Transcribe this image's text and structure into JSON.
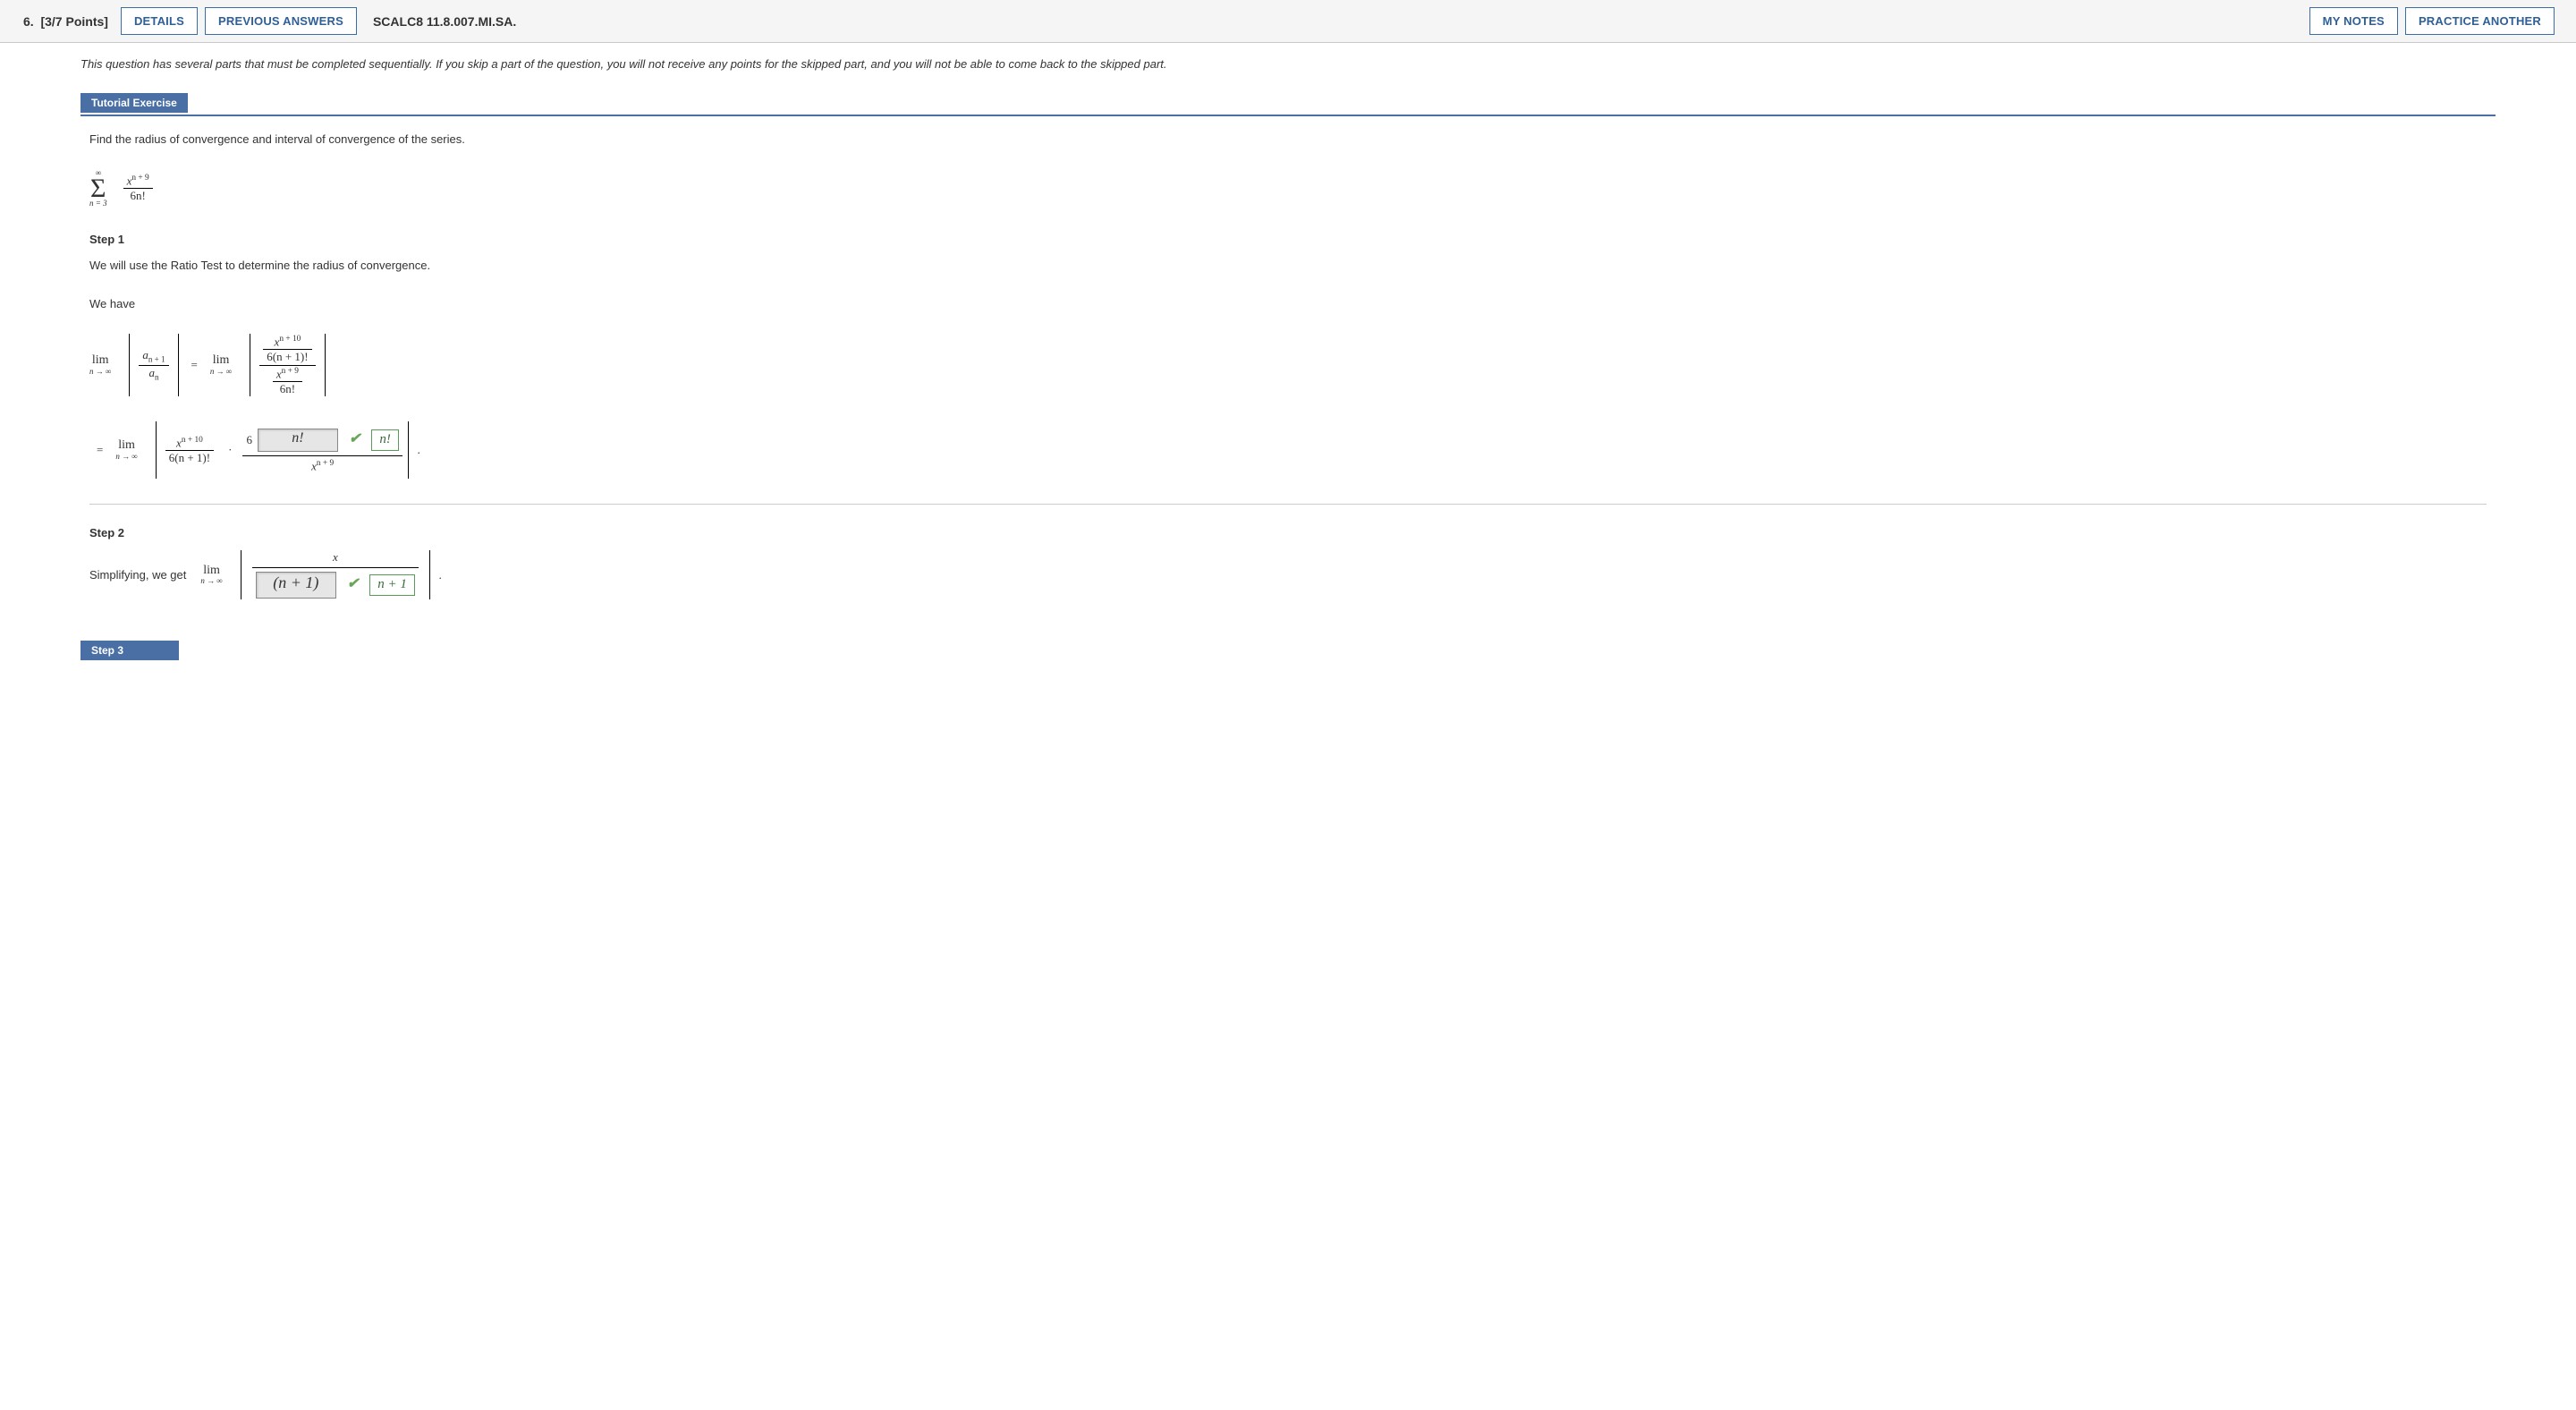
{
  "header": {
    "number_label": "6.",
    "points_label": "[3/7 Points]",
    "details_btn": "DETAILS",
    "prev_answers_btn": "PREVIOUS ANSWERS",
    "code": "SCALC8 11.8.007.MI.SA.",
    "my_notes_btn": "MY NOTES",
    "practice_btn": "PRACTICE ANOTHER"
  },
  "instructions": "This question has several parts that must be completed sequentially. If you skip a part of the question, you will not receive any points for the skipped part, and you will not be able to come back to the skipped part.",
  "section_tabs": {
    "tutorial": "Tutorial Exercise",
    "step3": "Step 3"
  },
  "tutorial_prompt": "Find the radius of convergence and interval of convergence of the series.",
  "sigma": {
    "top": "∞",
    "bottom": "n = 3",
    "frac_num": "x",
    "frac_num_exp": "n + 9",
    "frac_den": "6n!"
  },
  "step1": {
    "title": "Step 1",
    "line1": "We will use the Ratio Test to determine the radius of convergence.",
    "line2": "We have",
    "ratio_top": "a",
    "ratio_top_sub": "n + 1",
    "ratio_bot": "a",
    "ratio_bot_sub": "n",
    "rhs1_top_num": "x",
    "rhs1_top_exp": "n + 10",
    "rhs1_top_den": "6(n + 1)!",
    "rhs1_bot_num": "x",
    "rhs1_bot_exp": "n + 9",
    "rhs1_bot_den": "6n!",
    "rhs2_num": "x",
    "rhs2_num_exp": "n + 10",
    "rhs2_den": "6(n + 1)!",
    "six": "6",
    "input_val": "n!",
    "reveal": "n!",
    "rhs2_frac2_num": "",
    "rhs2_frac2_den_var": "x",
    "rhs2_frac2_den_exp": "n + 9"
  },
  "step2": {
    "title": "Step 2",
    "text_pre": "Simplifying, we get",
    "num_var": "x",
    "input_val": "(n + 1)",
    "reveal": "n + 1"
  },
  "glyphs": {
    "lim": "lim",
    "lim_sub": "n → ∞",
    "equals": "=",
    "cdot": "·",
    "period": "."
  }
}
